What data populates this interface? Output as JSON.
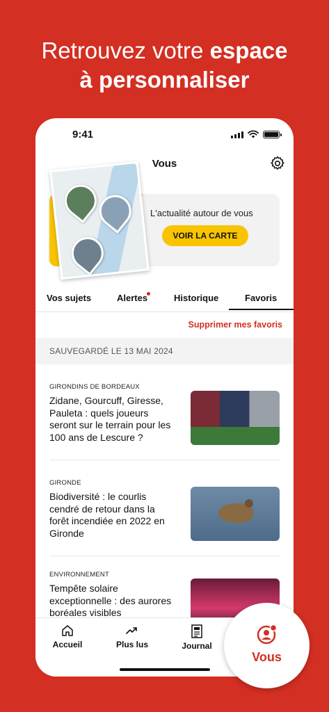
{
  "promo": {
    "line1_regular": "Retrouvez votre ",
    "line1_bold": "espace",
    "line2_bold": "à personnaliser"
  },
  "status_bar": {
    "time": "9:41"
  },
  "header": {
    "title": "Vous",
    "settings_icon": "gear-icon"
  },
  "map_card": {
    "text": "L'actualité autour de vous",
    "button": "VOIR LA CARTE",
    "accent": "#f8c400"
  },
  "tabs": [
    {
      "label": "Vos sujets",
      "active": false
    },
    {
      "label": "Alertes",
      "active": false,
      "badge": true
    },
    {
      "label": "Historique",
      "active": false
    },
    {
      "label": "Favoris",
      "active": true
    }
  ],
  "favorites": {
    "clear_label": "Supprimer mes favoris",
    "saved_heading": "SAUVEGARDÉ LE 13 MAI 2024",
    "articles": [
      {
        "category": "GIRONDINS DE BORDEAUX",
        "title": "Zidane, Gourcuff, Giresse, Pauleta : quels joueurs seront sur le terrain pour les 100 ans de Lescure ?"
      },
      {
        "category": "GIRONDE",
        "title": "Biodiversité : le courlis cendré de retour dans la forêt incendiée en 2022 en Gironde"
      },
      {
        "category": "ENVIRONNEMENT",
        "title": "Tempête solaire exceptionnelle : des aurores boréales visibles"
      }
    ]
  },
  "bottom_nav": {
    "items": [
      {
        "label": "Accueil",
        "icon": "home-icon"
      },
      {
        "label": "Plus lus",
        "icon": "trending-icon"
      },
      {
        "label": "Journal",
        "icon": "newspaper-icon"
      },
      {
        "label": "Vous",
        "icon": "user-icon",
        "active": true
      }
    ]
  },
  "colors": {
    "brand_red": "#d32f22",
    "accent_yellow": "#f8c400"
  }
}
